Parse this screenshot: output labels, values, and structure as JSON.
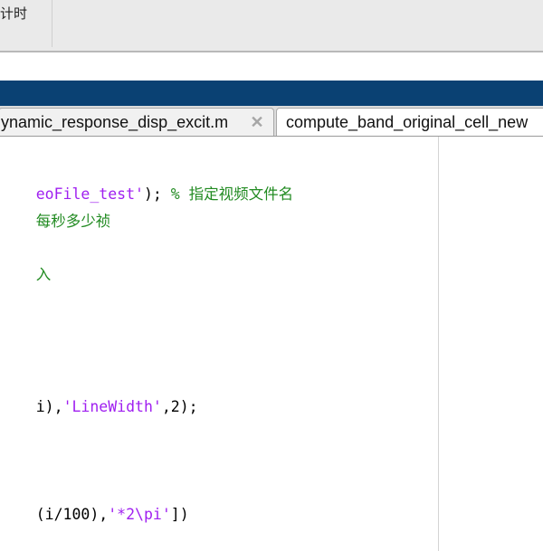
{
  "toolstrip": {
    "label": "计时"
  },
  "tabs": [
    {
      "label": "ynamic_response_disp_excit.m",
      "close_glyph": "✕",
      "active": false
    },
    {
      "label": "compute_band_original_cell_new",
      "active": true
    }
  ],
  "code_lines": {
    "line1_str": "eoFile_test'",
    "line1_plain": "); ",
    "line1_cmt": "% 指定视频文件名",
    "line2_cmt": "每秒多少祯",
    "line3_cmt": "入",
    "line4_plain_a": "i),",
    "line4_str": "'LineWidth'",
    "line4_plain_b": ",2);",
    "line5_plain_a": "(i/100),",
    "line5_str": "'*2\\pi'",
    "line5_plain_b": "])"
  }
}
